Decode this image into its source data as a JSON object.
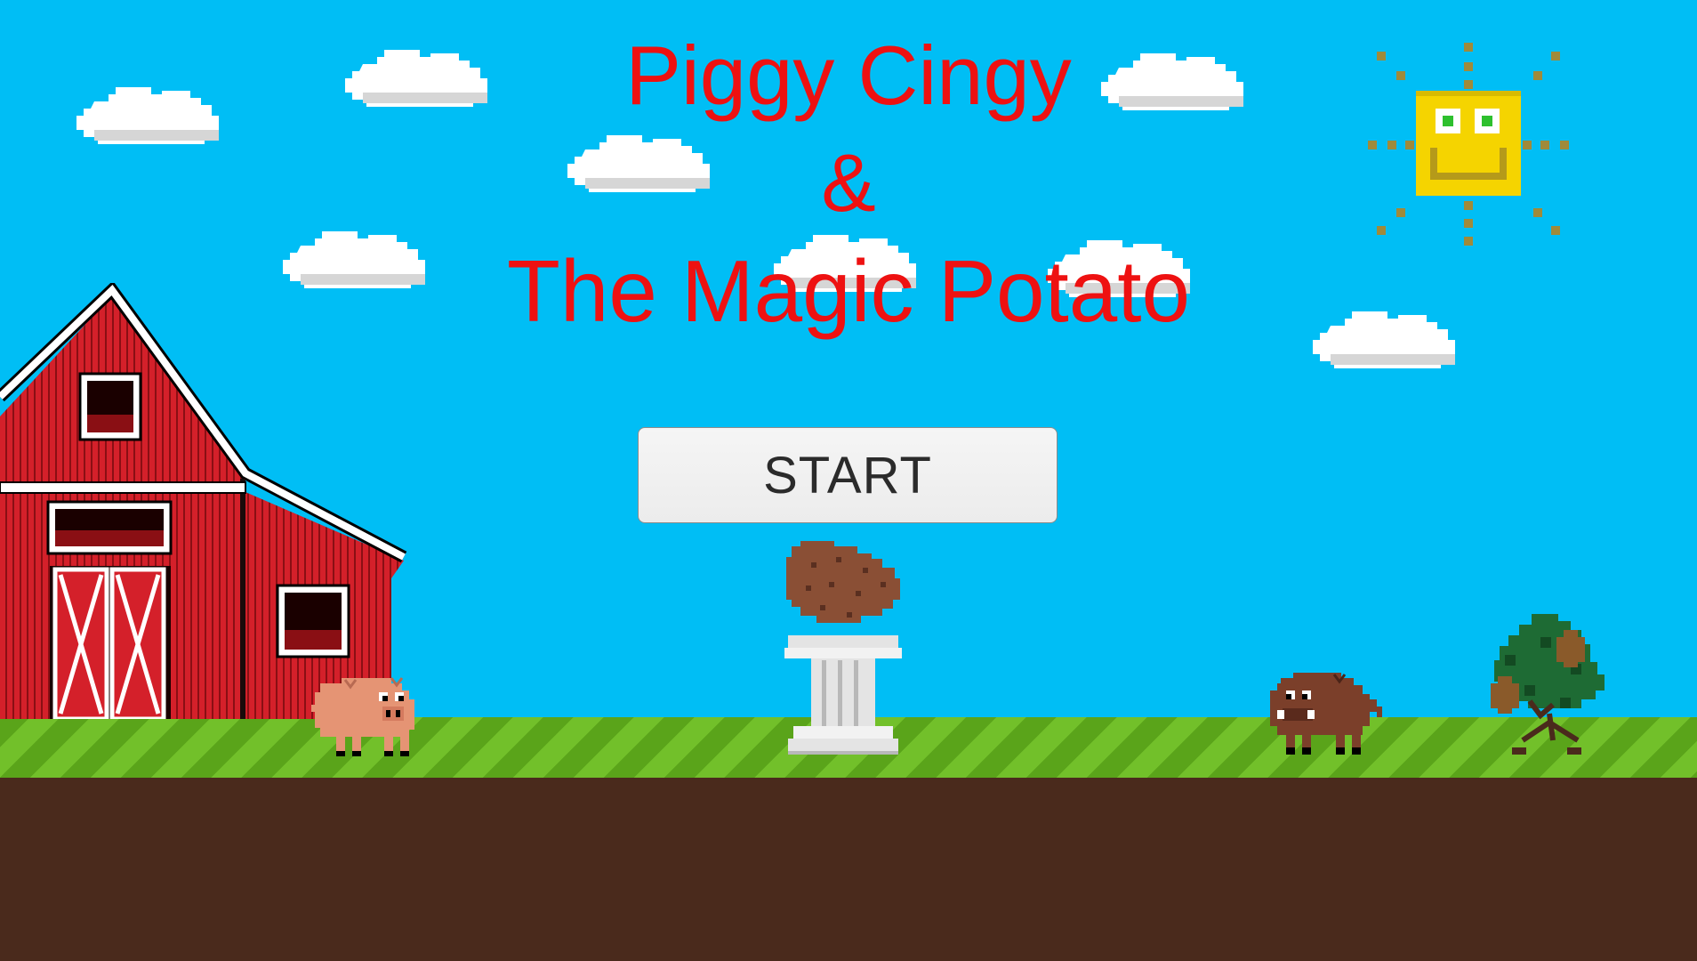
{
  "title": {
    "line1": "Piggy Cingy",
    "line2": "&",
    "line3": "The Magic Potato",
    "color": "#ee1111"
  },
  "menu": {
    "start_label": "START",
    "text_color": "#2b2b2b"
  },
  "colors": {
    "sky": "#00bef5",
    "grass_dark": "#5aa41a",
    "grass_light": "#72c02a",
    "dirt": "#4a2a1c",
    "barn_red": "#d4202a",
    "sun_yellow": "#f5d400",
    "pig_pink": "#e59474",
    "boar_brown": "#7b3f2a",
    "potato_brown": "#8a4f35",
    "pedestal_white": "#e4e4e4"
  },
  "icons": [
    "cloud-icon",
    "sun-icon",
    "barn-icon",
    "pig-icon",
    "potato-icon",
    "pedestal-icon",
    "boar-icon",
    "potato-bush-icon"
  ]
}
